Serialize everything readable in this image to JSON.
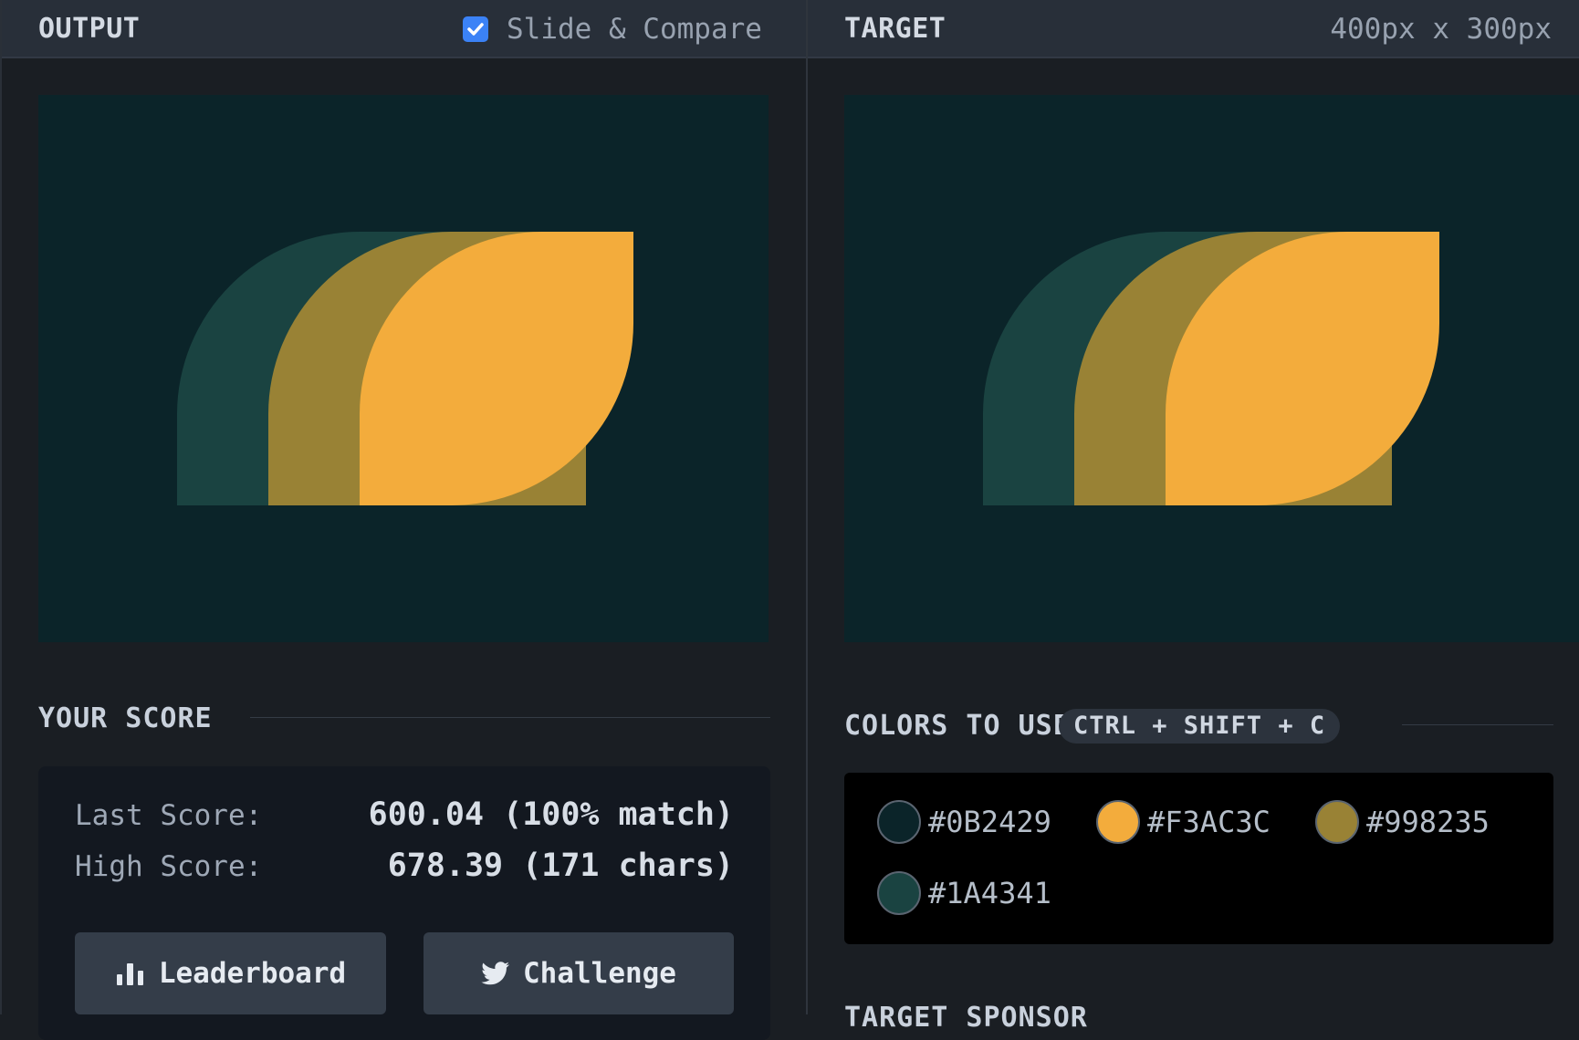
{
  "output": {
    "title": "OUTPUT",
    "compare_checked": true,
    "compare_label": "Slide & Compare"
  },
  "target": {
    "title": "TARGET",
    "size": "400px x 300px"
  },
  "score": {
    "heading": "YOUR SCORE",
    "last_label": "Last Score:",
    "last_value": "600.04 (100% match)",
    "high_label": "High Score:",
    "high_value": "678.39 (171 chars)",
    "leaderboard_label": "Leaderboard",
    "challenge_label": "Challenge"
  },
  "colors": {
    "heading": "COLORS TO USE",
    "shortcut": "CTRL + SHIFT + C",
    "swatches": [
      {
        "hex": "#0B2429"
      },
      {
        "hex": "#F3AC3C"
      },
      {
        "hex": "#998235"
      },
      {
        "hex": "#1A4341"
      }
    ]
  },
  "sponsor_heading": "TARGET SPONSOR",
  "palette": {
    "background": "#0B2429",
    "leaf_front": "#F3AC3C",
    "leaf_middle": "#998235",
    "leaf_back": "#1A4341",
    "accent_checkbox": "#3B82F6"
  }
}
